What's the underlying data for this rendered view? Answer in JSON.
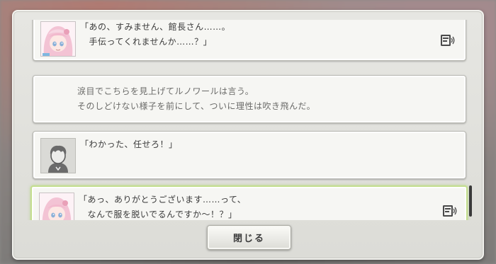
{
  "backlog": {
    "entries": [
      {
        "speaker_portrait": "pink-haired-girl-portrait",
        "lines": [
          "「あの、すみません、館長さん……。",
          "　手伝ってくれませんか……？」"
        ],
        "has_voice": true,
        "active": false
      },
      {
        "speaker_portrait": null,
        "lines": [
          "涙目でこちらを見上げてルノワールは言う。",
          "そのしどけない様子を前にして、ついに理性は吹き飛んだ。"
        ],
        "has_voice": false,
        "active": false
      },
      {
        "speaker_portrait": "player-silhouette-portrait",
        "lines": [
          "「わかった、任せろ！」"
        ],
        "has_voice": false,
        "active": false
      },
      {
        "speaker_portrait": "pink-haired-girl-portrait",
        "lines": [
          "「あっ、ありがとうございます……って、",
          "　なんで服を脱いでるんですか～！？」"
        ],
        "has_voice": true,
        "active": true
      }
    ]
  },
  "close_button": {
    "label": "閉じる"
  },
  "colors": {
    "active_border": "#c3de8e",
    "panel_bg": "#e3e3df",
    "text": "#3a3a3a"
  },
  "icons": {
    "voice": "voice-replay-icon"
  }
}
